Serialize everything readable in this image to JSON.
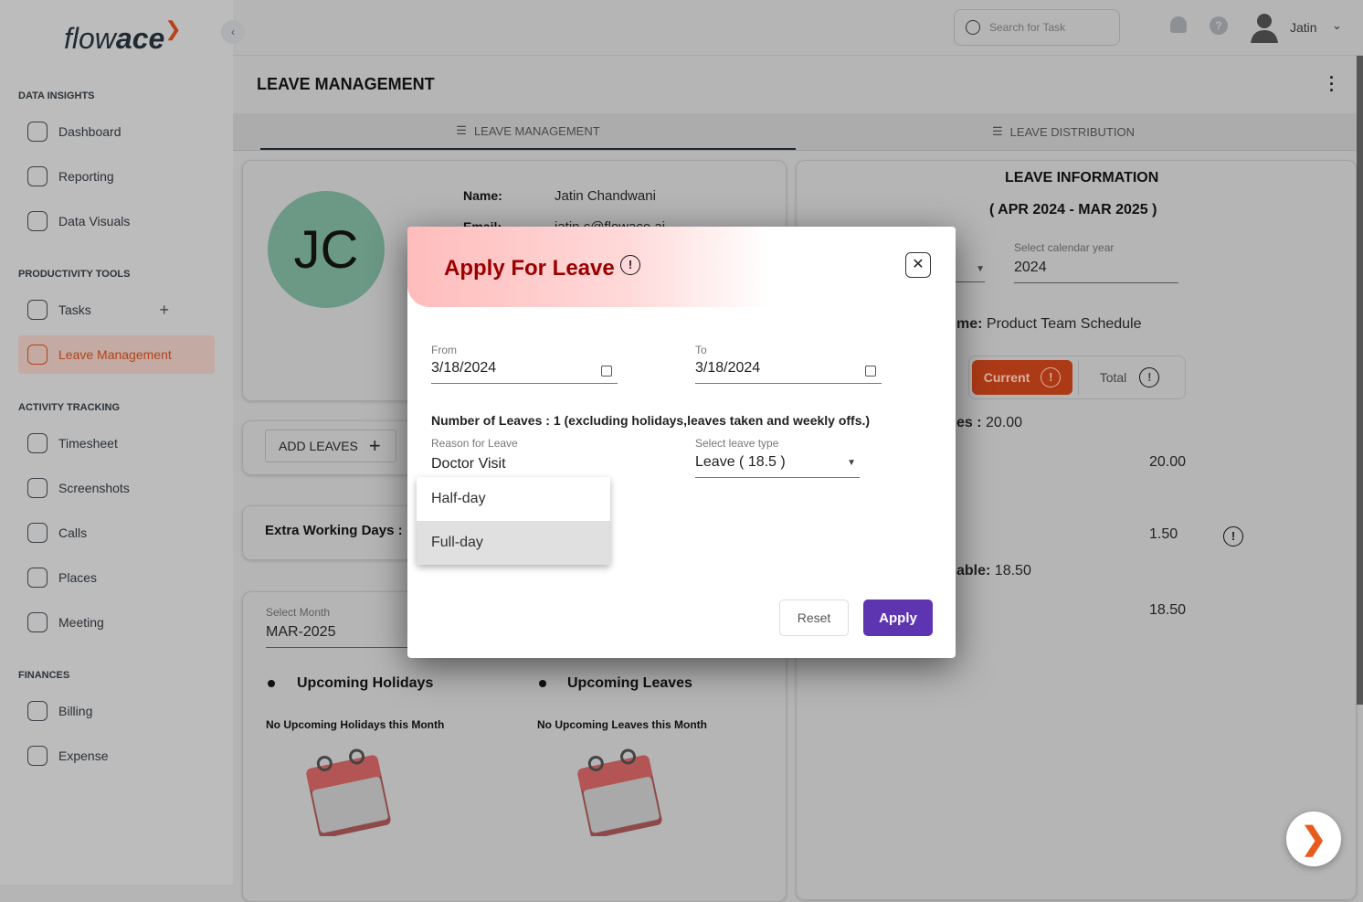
{
  "brand": {
    "logo_light": "flow",
    "logo_bold": "ace"
  },
  "sidebar": {
    "sections": [
      {
        "title": "DATA INSIGHTS",
        "items": [
          {
            "label": "Dashboard",
            "icon": "grid-icon"
          },
          {
            "label": "Reporting",
            "icon": "report-icon"
          },
          {
            "label": "Data Visuals",
            "icon": "pie-chart-icon"
          }
        ]
      },
      {
        "title": "PRODUCTIVITY TOOLS",
        "items": [
          {
            "label": "Tasks",
            "icon": "tasks-icon"
          },
          {
            "label": "Leave Management",
            "icon": "leave-icon",
            "active": true
          }
        ]
      },
      {
        "title": "ACTIVITY TRACKING",
        "items": [
          {
            "label": "Timesheet",
            "icon": "clock-icon"
          },
          {
            "label": "Screenshots",
            "icon": "camera-icon"
          },
          {
            "label": "Calls",
            "icon": "phone-icon"
          },
          {
            "label": "Places",
            "icon": "location-icon"
          },
          {
            "label": "Meeting",
            "icon": "meeting-icon"
          }
        ]
      },
      {
        "title": "FINANCES",
        "items": [
          {
            "label": "Billing",
            "icon": "billing-icon"
          },
          {
            "label": "Expense",
            "icon": "wallet-icon"
          }
        ]
      }
    ]
  },
  "header": {
    "search_placeholder": "Search for Task",
    "user": "Jatin"
  },
  "page": {
    "title": "LEAVE MANAGEMENT",
    "tabs": [
      "LEAVE MANAGEMENT",
      "LEAVE DISTRIBUTION"
    ]
  },
  "profile": {
    "initials": "JC",
    "name_label": "Name:",
    "name": "Jatin Chandwani",
    "email_label": "Email:",
    "email": "jatin.c@flowace.ai"
  },
  "add_leaves": "ADD LEAVES",
  "extra_working_days": "Extra Working Days :",
  "month": {
    "label": "Select Month",
    "value": "MAR-2025"
  },
  "upcoming": {
    "holidays_title": "Upcoming Holidays",
    "holidays_empty": "No Upcoming Holidays this Month",
    "leaves_title": "Upcoming Leaves",
    "leaves_empty": "No Upcoming Leaves this Month"
  },
  "leave_info": {
    "title": "LEAVE INFORMATION",
    "period": "( APR  2024  - MAR  2025 )",
    "year_label": "Select calendar year",
    "year": "2024",
    "schedule_label": "me:",
    "schedule": "Product Team Schedule",
    "toggle": {
      "current": "Current",
      "total": "Total"
    },
    "leaves_label": "es :",
    "leaves": "20.00",
    "v1": "20.00",
    "v2": "1.50",
    "available_label": "able:",
    "available": "18.50",
    "v3": "18.50"
  },
  "modal": {
    "title": "Apply For Leave",
    "from_label": "From",
    "from": "3/18/2024",
    "to_label": "To",
    "to": "3/18/2024",
    "count_text": "Number of Leaves : 1 (excluding holidays,leaves taken and weekly offs.)",
    "reason_label": "Reason for Leave",
    "reason": "Doctor Visit",
    "type_label": "Select leave type",
    "type": "Leave  ( 18.5 )",
    "options": [
      "Half-day",
      "Full-day"
    ],
    "reset": "Reset",
    "apply": "Apply"
  },
  "colors": {
    "accent": "#b5421b",
    "primary_button": "#5e35b1",
    "modal_title": "#9b0000"
  }
}
